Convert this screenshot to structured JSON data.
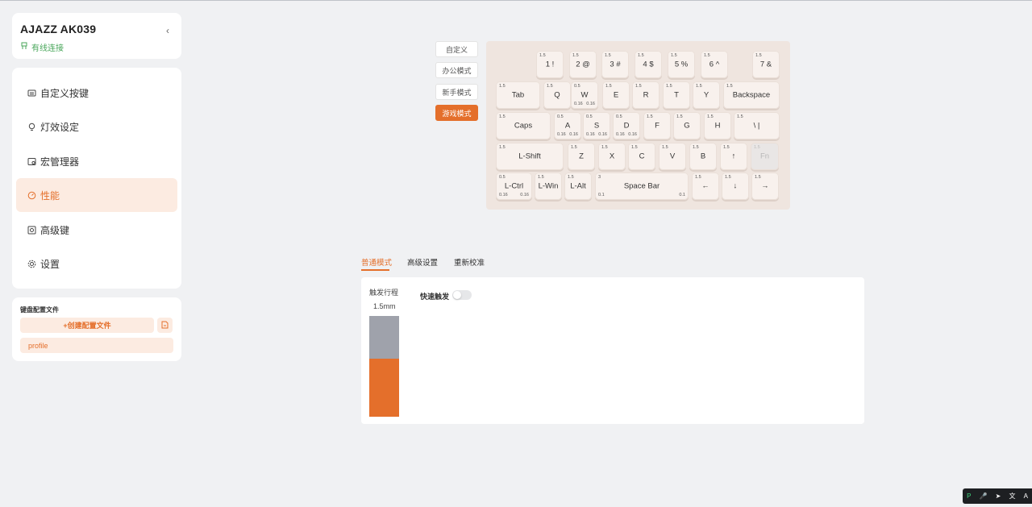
{
  "device": {
    "name": "AJAZZ AK039",
    "status": "有线连接",
    "collapse_icon": "chevron-left-icon"
  },
  "nav": {
    "items": [
      {
        "label": "自定义按键",
        "icon": "keyboard-icon"
      },
      {
        "label": "灯效设定",
        "icon": "bulb-icon"
      },
      {
        "label": "宏管理器",
        "icon": "macro-icon"
      },
      {
        "label": "性能",
        "icon": "gauge-icon",
        "active": true
      },
      {
        "label": "高级键",
        "icon": "advanced-key-icon"
      },
      {
        "label": "设置",
        "icon": "gear-icon"
      }
    ]
  },
  "profiles": {
    "title": "键盘配置文件",
    "create_label": "+创建配置文件",
    "import_icon": "file-import-icon",
    "items": [
      "profile"
    ]
  },
  "modes": [
    "自定义",
    "办公模式",
    "新手模式",
    "游戏模式"
  ],
  "active_mode": "游戏模式",
  "keyboard": {
    "keys": [
      {
        "label": "1 !",
        "tl": "1.5"
      },
      {
        "label": "2 @",
        "tl": "1.5"
      },
      {
        "label": "3 #",
        "tl": "1.5"
      },
      {
        "label": "4 $",
        "tl": "1.5"
      },
      {
        "label": "5 %",
        "tl": "1.5"
      },
      {
        "label": "6 ^",
        "tl": "1.5"
      },
      {
        "label": "7 &",
        "tl": "1.5"
      },
      {
        "label": "Tab",
        "tl": "1.5"
      },
      {
        "label": "Q",
        "tl": "1.5"
      },
      {
        "label": "W",
        "tl": "0.5",
        "bl": "0.16",
        "br": "0.16"
      },
      {
        "label": "E",
        "tl": "1.5"
      },
      {
        "label": "R",
        "tl": "1.5"
      },
      {
        "label": "T",
        "tl": "1.5"
      },
      {
        "label": "Y",
        "tl": "1.5"
      },
      {
        "label": "Backspace",
        "tl": "1.5"
      },
      {
        "label": "Caps",
        "tl": "1.5"
      },
      {
        "label": "A",
        "tl": "0.5",
        "bl": "0.16",
        "br": "0.16"
      },
      {
        "label": "S",
        "tl": "0.5",
        "bl": "0.16",
        "br": "0.16"
      },
      {
        "label": "D",
        "tl": "0.5",
        "bl": "0.16",
        "br": "0.16"
      },
      {
        "label": "F",
        "tl": "1.5"
      },
      {
        "label": "G",
        "tl": "1.5"
      },
      {
        "label": "H",
        "tl": "1.5"
      },
      {
        "label": "\\ |",
        "tl": "1.5"
      },
      {
        "label": "L-Shift",
        "tl": "1.5"
      },
      {
        "label": "Z",
        "tl": "1.5"
      },
      {
        "label": "X",
        "tl": "1.5"
      },
      {
        "label": "C",
        "tl": "1.5"
      },
      {
        "label": "V",
        "tl": "1.5"
      },
      {
        "label": "B",
        "tl": "1.5"
      },
      {
        "label": "↑",
        "tl": "1.5"
      },
      {
        "label": "Fn",
        "tl": "1.5",
        "disabled": true
      },
      {
        "label": "L-Ctrl",
        "tl": "0.5",
        "bl": "0.16",
        "br": "0.16"
      },
      {
        "label": "L-Win",
        "tl": "1.5"
      },
      {
        "label": "L-Alt",
        "tl": "1.5"
      },
      {
        "label": "Space Bar",
        "tl": "3",
        "bl": "0.1",
        "br": "0.1"
      },
      {
        "label": "←",
        "tl": "1.5"
      },
      {
        "label": "↓",
        "tl": "1.5"
      },
      {
        "label": "→",
        "tl": "1.5"
      }
    ]
  },
  "tabs": [
    "普通模式",
    "高级设置",
    "重新校准"
  ],
  "active_tab": "普通模式",
  "trigger": {
    "label": "触发行程",
    "value": "1.5mm",
    "fill_fraction": 0.58
  },
  "rapid_trigger": {
    "label": "快速触发",
    "enabled": false
  },
  "tray": [
    "P",
    "🎤",
    "➤",
    "文",
    "A"
  ],
  "colors": {
    "accent": "#e46f2b",
    "accent_soft": "#fcebe1",
    "connected": "#48a65a"
  }
}
